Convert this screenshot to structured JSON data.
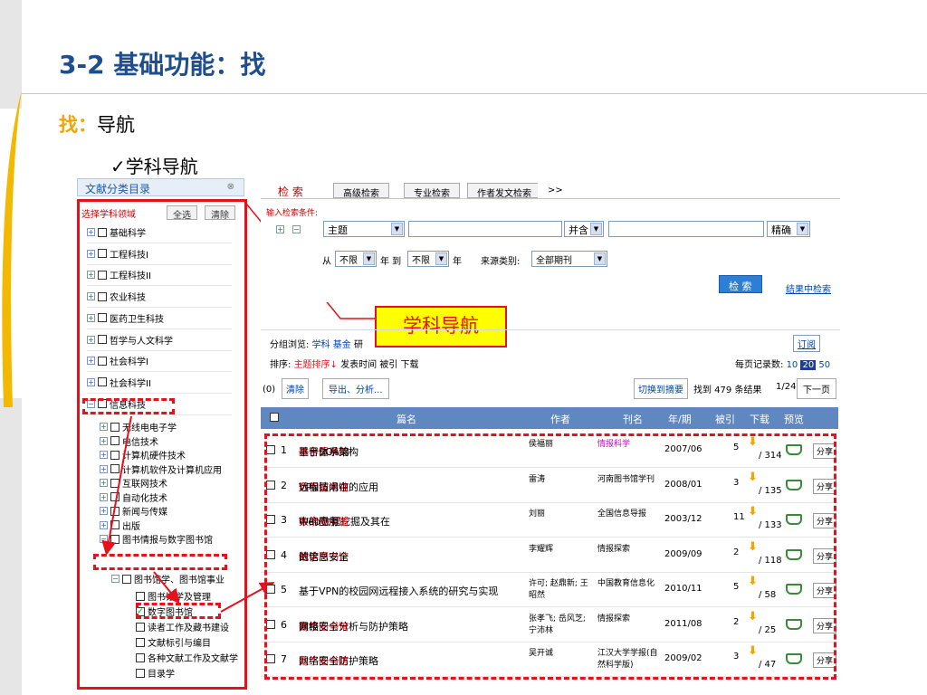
{
  "slide": {
    "title": "3-2 基础功能：找",
    "subtitle_key": "找：",
    "subtitle_rest": "导航",
    "bullet": "✓学科导航",
    "callout": "学科导航"
  },
  "left_panel": {
    "header": "文献分类目录",
    "collapse_icon": "⊗",
    "select_label": "选择学科领域",
    "select_all": "全选",
    "clear": "清除",
    "top_items": [
      "基础科学",
      "工程科技I",
      "工程科技II",
      "农业科技",
      "医药卫生科技",
      "哲学与人文科学",
      "社会科学I",
      "社会科学II",
      "信息科技"
    ],
    "sub_items": [
      "无线电电子学",
      "电信技术",
      "计算机硬件技术",
      "计算机软件及计算机应用",
      "互联网技术",
      "自动化技术",
      "新闻与传媒",
      "出版",
      "图书情报与数字图书馆"
    ],
    "sub_sub": "图书馆学、图书馆事业",
    "leaf_items": [
      "图书馆学及管理",
      "数字图书馆",
      "读者工作及藏书建设",
      "文献标引与编目",
      "各种文献工作及文献学",
      "目录学"
    ]
  },
  "search": {
    "tabs": [
      "检 索",
      "高级检索",
      "专业检索",
      "作者发文检索",
      ">>"
    ],
    "input_label": "输入检索条件:",
    "field": "主题",
    "logic": "并含",
    "match": "精确",
    "from": "从",
    "year_from": "不限",
    "year_to_label": "年 到",
    "year_to": "不限",
    "year_suffix": "年",
    "source_label": "来源类别:",
    "source": "全部期刊",
    "search_btn": "检 索",
    "in_results": "结果中检索"
  },
  "results": {
    "group_label": "分组浏览:",
    "group_items": [
      "学科",
      "基金",
      "研"
    ],
    "subscribe": "订阅",
    "sort_label": "排序:",
    "sort_items": [
      "主题排序↓",
      "发表时间",
      "被引",
      "下载"
    ],
    "per_page_label": "每页记录数:",
    "per_page": [
      "10",
      "20",
      "50"
    ],
    "selected": "(0)",
    "clear": "清除",
    "export": "导出、分析...",
    "switch": "切换到摘要",
    "found": "找到 479 条结果",
    "page": "1/24",
    "next": "下一页",
    "columns": [
      "篇名",
      "作者",
      "刊名",
      "年/期",
      "被引",
      "下载",
      "预览"
    ],
    "share": "分享",
    "rows": [
      {
        "n": "1",
        "pre": "基于SOA的",
        "hl": "数字图书馆",
        "post": "平台体系架构",
        "author": "侯福丽",
        "journal": "情报科学",
        "jmag": true,
        "year": "2007/06",
        "cited": "5",
        "down": "/ 314"
      },
      {
        "n": "2",
        "pre": "VPN技术在",
        "hl": "数字图书馆",
        "post": "远程访问中的应用",
        "author": "雷涛",
        "journal": "河南图书馆学刊",
        "jmag": false,
        "year": "2008/01",
        "cited": "3",
        "down": "/ 135"
      },
      {
        "n": "3",
        "pre": "Web数据挖掘及其在",
        "hl": "数字图书馆",
        "post": "中的应用",
        "author": "刘丽",
        "journal": "全国信息导报",
        "jmag": false,
        "year": "2003/12",
        "cited": "11",
        "down": "/ 133"
      },
      {
        "n": "4",
        "pre": "试论",
        "hl": "数字图书馆",
        "post": "的信息安全",
        "author": "李耀辉",
        "journal": "情报探索",
        "jmag": false,
        "year": "2009/09",
        "cited": "2",
        "down": "/ 118"
      },
      {
        "n": "5",
        "pre": "基于VPN的校园网远程接入系统的研究与实现",
        "hl": "",
        "post": "",
        "author": "许可; 赵鼎新; 王昭然",
        "journal": "中国教育信息化",
        "jmag": false,
        "year": "2010/11",
        "cited": "5",
        "down": "/ 58"
      },
      {
        "n": "6",
        "pre": "高校",
        "hl": "数字图书馆",
        "post": "网络安全分析与防护策略",
        "author": "张孝飞; 岳风芝; 宁沛林",
        "journal": "情报探索",
        "jmag": false,
        "year": "2011/08",
        "cited": "2",
        "down": "/ 25"
      },
      {
        "n": "7",
        "pre": "",
        "hl": "数字图书馆",
        "post": "网络安全防护策略",
        "author": "吴开诚",
        "journal": "江汉大学学报(自然科学版)",
        "jmag": false,
        "year": "2009/02",
        "cited": "3",
        "down": "/ 47"
      }
    ]
  },
  "colors": {
    "accent_red": "#e8101a",
    "title_blue": "#1f4e8c",
    "key_orange": "#f3a400",
    "header_blue": "#5f87c0"
  }
}
